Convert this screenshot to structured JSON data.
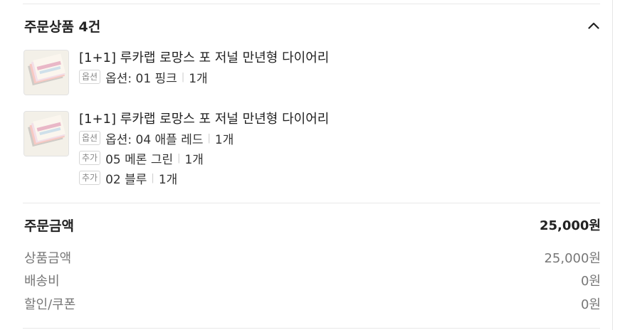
{
  "order_items": {
    "title": "주문상품 4건",
    "collapse_icon": "chevron-up-icon",
    "items": [
      {
        "name": "[1+1] 루카랩 로망스 포 저널 만년형 다이어리",
        "options": [
          {
            "tag": "옵션",
            "label": "옵션: 01 핑크",
            "qty": "1개"
          }
        ]
      },
      {
        "name": "[1+1] 루카랩 로망스 포 저널 만년형 다이어리",
        "options": [
          {
            "tag": "옵션",
            "label": "옵션: 04 애플 레드",
            "qty": "1개"
          },
          {
            "tag": "추가",
            "label": "05 메론 그린",
            "qty": "1개"
          },
          {
            "tag": "추가",
            "label": "02 블루",
            "qty": "1개"
          }
        ]
      }
    ]
  },
  "summary": {
    "title": "주문금액",
    "total": "25,000원",
    "rows": [
      {
        "label": "상품금액",
        "value": "25,000원"
      },
      {
        "label": "배송비",
        "value": "0원"
      },
      {
        "label": "할인/쿠폰",
        "value": "0원"
      }
    ]
  }
}
